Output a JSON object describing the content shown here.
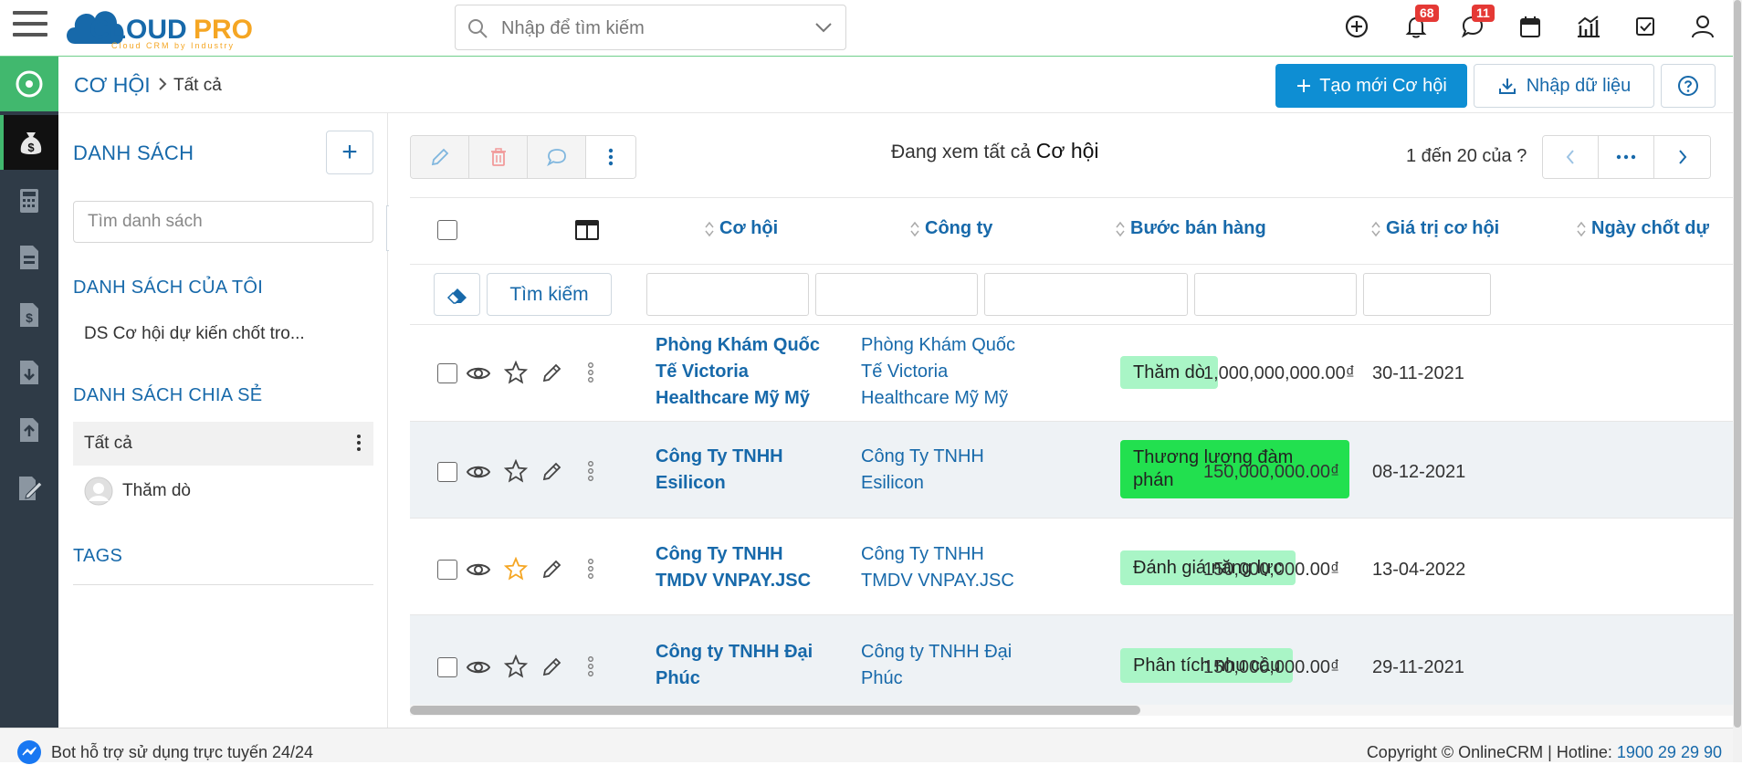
{
  "app": {
    "logo_text": "CLOUDPRO",
    "logo_sub": "Cloud CRM by Industry",
    "brand_color": "#0e8ed3",
    "accent_green": "#41b86e"
  },
  "topbar": {
    "search_placeholder": "Nhập để tìm kiếm",
    "notifications_count": "68",
    "messages_count": "11"
  },
  "header": {
    "module": "CƠ HỘI",
    "current": "Tất cả",
    "create_label": "Tạo mới Cơ hội",
    "import_label": "Nhập dữ liệu"
  },
  "listpanel": {
    "title": "DANH SÁCH",
    "search_placeholder": "Tìm danh sách",
    "my_lists_title": "DANH SÁCH CỦA TÔI",
    "my_lists": [
      "DS Cơ hội dự kiến chốt tro..."
    ],
    "shared_title": "DANH SÁCH CHIA SẺ",
    "shared": [
      "Tất cả",
      "Thăm dò"
    ],
    "tags_title": "TAGS"
  },
  "main": {
    "viewing_prefix": "Đang xem tất cả",
    "viewing_module": "Cơ hội",
    "pager_text": "1 đến 20 của ?",
    "search_button": "Tìm kiếm",
    "columns": [
      "Cơ hội",
      "Công ty",
      "Bước bán hàng",
      "Giá trị cơ hội",
      "Ngày chốt dự"
    ],
    "rows": [
      {
        "opp": [
          "Phòng Khám Quốc",
          "Tế Victoria",
          "Healthcare Mỹ Mỹ"
        ],
        "company": [
          "Phòng Khám Quốc",
          "Tế Victoria",
          "Healthcare Mỹ Mỹ"
        ],
        "stage": [
          "Thăm dò"
        ],
        "stage_color": "#a9f5c6",
        "value": "1,000,000,000.00₫",
        "date": "30-11-2021",
        "starred": false
      },
      {
        "opp": [
          "Công Ty TNHH",
          "Esilicon"
        ],
        "company": [
          "Công Ty TNHH",
          "Esilicon"
        ],
        "stage": [
          "Thương lượng đàm",
          "phán"
        ],
        "stage_color": "#22e04f",
        "value": "150,000,000.00₫",
        "date": "08-12-2021",
        "starred": false
      },
      {
        "opp": [
          "Công Ty TNHH",
          "TMDV VNPAY.JSC"
        ],
        "company": [
          "Công Ty TNHH",
          "TMDV VNPAY.JSC"
        ],
        "stage": [
          "Đánh giá năng lực"
        ],
        "stage_color": "#a9f5c6",
        "value": "150,000,000.00₫",
        "date": "13-04-2022",
        "starred": true
      },
      {
        "opp": [
          "Công ty TNHH Đại",
          "Phúc"
        ],
        "company": [
          "Công ty TNHH Đại",
          "Phúc"
        ],
        "stage": [
          "Phân tích nhu cầu"
        ],
        "stage_color": "#a9f5c6",
        "value": "150,000,000.00₫",
        "date": "29-11-2021",
        "starred": false
      }
    ]
  },
  "footer": {
    "bot_text": "Bot hỗ trợ sử dụng trực tuyến 24/24",
    "copyright": "Copyright © OnlineCRM | Hotline:",
    "hotline": "1900 29 29 90"
  }
}
